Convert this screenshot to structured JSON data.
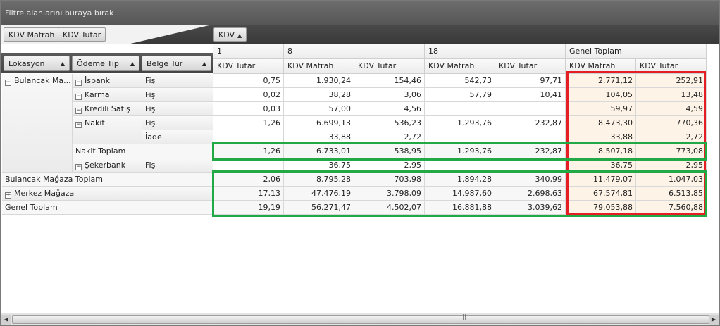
{
  "filter_area": {
    "placeholder": "Filtre alanlarını buraya bırak"
  },
  "data_fields": [
    "KDV Matrah",
    "KDV Tutar"
  ],
  "column_field": {
    "label": "KDV"
  },
  "row_fields": [
    "Lokasyon",
    "Ödeme Tip",
    "Belge Tür"
  ],
  "column_groups": [
    "1",
    "8",
    "18",
    "Genel Toplam"
  ],
  "value_headers": [
    "KDV Tutar",
    "KDV Matrah",
    "KDV Tutar",
    "KDV Matrah",
    "KDV Tutar",
    "KDV Matrah",
    "KDV Tutar"
  ],
  "rows": [
    {
      "lok": "Bulancak Ma...",
      "odeme": "İşbank",
      "belge": "Fiş",
      "v": [
        "0,75",
        "1.930,24",
        "154,46",
        "542,73",
        "97,71",
        "2.771,12",
        "252,91"
      ]
    },
    {
      "lok": "",
      "odeme": "Karma",
      "belge": "Fiş",
      "v": [
        "0,02",
        "38,28",
        "3,06",
        "57,79",
        "10,41",
        "104,05",
        "13,48"
      ]
    },
    {
      "lok": "",
      "odeme": "Kredili Satış",
      "belge": "Fiş",
      "v": [
        "0,03",
        "57,00",
        "4,56",
        "",
        "",
        "59,97",
        "4,59"
      ]
    },
    {
      "lok": "",
      "odeme": "Nakit",
      "belge": "Fiş",
      "v": [
        "1,26",
        "6.699,13",
        "536,23",
        "1.293,76",
        "232,87",
        "8.473,30",
        "770,36"
      ]
    },
    {
      "lok": "",
      "odeme": "",
      "belge": "İade",
      "v": [
        "",
        "33,88",
        "2,72",
        "",
        "",
        "33,88",
        "2,72"
      ]
    },
    {
      "lok": "",
      "odeme": "Nakit Toplam",
      "belge": "",
      "v": [
        "1,26",
        "6.733,01",
        "538,95",
        "1.293,76",
        "232,87",
        "8.507,18",
        "773,08"
      ]
    },
    {
      "lok": "",
      "odeme": "Şekerbank",
      "belge": "Fiş",
      "v": [
        "",
        "36,75",
        "2,95",
        "",
        "",
        "36,75",
        "2,95"
      ]
    },
    {
      "lok": "Bulancak Mağaza Toplam",
      "odeme": "",
      "belge": "",
      "v": [
        "2,06",
        "8.795,28",
        "703,98",
        "1.894,28",
        "340,99",
        "11.479,07",
        "1.047,03"
      ]
    },
    {
      "lok": "Merkez Mağaza",
      "odeme": "",
      "belge": "",
      "v": [
        "17,13",
        "47.476,19",
        "3.798,09",
        "14.987,60",
        "2.698,63",
        "67.574,81",
        "6.513,85"
      ]
    },
    {
      "lok": "Genel Toplam",
      "odeme": "",
      "belge": "",
      "v": [
        "19,19",
        "56.271,47",
        "4.502,07",
        "16.881,88",
        "3.039,62",
        "79.053,88",
        "7.560,88"
      ]
    }
  ],
  "colors": {
    "highlight_red": "#e51e25",
    "highlight_green": "#22a845",
    "grand_total_bg": "#fdf3e6"
  },
  "icons": {
    "expand": "plus-box-icon",
    "collapse": "minus-box-icon",
    "sort": "sort-up-triangle-icon"
  }
}
